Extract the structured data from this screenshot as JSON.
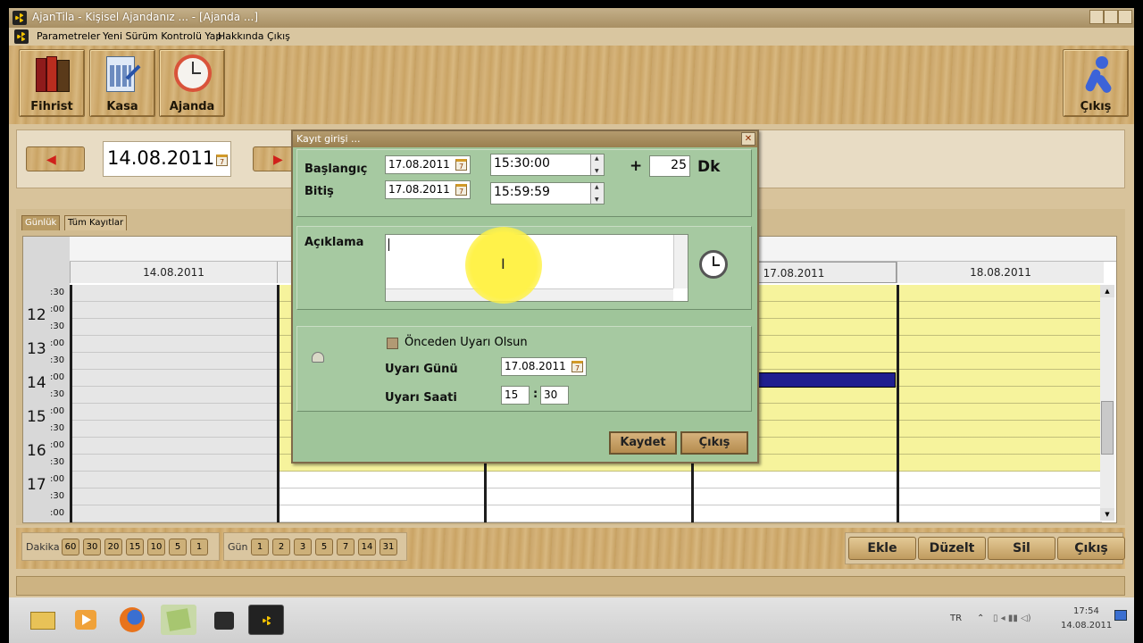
{
  "window": {
    "title": "AjanTila - Kişisel Ajandanız ... - [Ajanda ...]"
  },
  "menu": [
    "Parametreler",
    "Yeni Sürüm Kontrolü Yap",
    "Hakkında",
    "Çıkış"
  ],
  "toolbar": {
    "fihrist": "Fihrist",
    "kasa": "Kasa",
    "ajanda": "Ajanda",
    "cikis": "Çıkış"
  },
  "datenav": {
    "current_date": "14.08.2011"
  },
  "tabs": [
    "Günlük",
    "Tüm Kayıtlar"
  ],
  "grid": {
    "columns": [
      "14.08.2011",
      "17.08.2011",
      "18.08.2011"
    ],
    "hours": [
      "12",
      "13",
      "14",
      "15",
      "16",
      "17"
    ],
    "minutes": [
      ":30",
      ":00",
      ":30",
      ":00",
      ":30",
      ":00",
      ":30",
      ":00",
      ":30",
      ":00",
      ":30",
      ":00",
      ":30",
      ":00"
    ]
  },
  "bottom": {
    "dakika_label": "Dakika",
    "dakika_values": [
      "60",
      "30",
      "20",
      "15",
      "10",
      "5",
      "1"
    ],
    "gun_label": "Gün",
    "gun_values": [
      "1",
      "2",
      "3",
      "5",
      "7",
      "14",
      "31"
    ],
    "actions": [
      "Ekle",
      "Düzelt",
      "Sil",
      "Çıkış"
    ]
  },
  "dialog": {
    "title": "Kayıt girişi ...",
    "baslangic_label": "Başlangıç",
    "bitis_label": "Bitiş",
    "start_date": "17.08.2011",
    "end_date": "17.08.2011",
    "start_time": "15:30:00",
    "end_time": "15:59:59",
    "plus": "+",
    "duration": "25",
    "duration_unit": "Dk",
    "aciklama_label": "Açıklama",
    "reminder_checkbox": "Önceden Uyarı Olsun",
    "uyari_gunu_label": "Uyarı Günü",
    "uyari_gunu": "17.08.2011",
    "uyari_saati_label": "Uyarı Saati",
    "uyari_hour": "15",
    "uyari_sep": ":",
    "uyari_minute": "30",
    "save": "Kaydet",
    "exit": "Çıkış"
  },
  "taskbar": {
    "lang": "TR",
    "time": "17:54",
    "date": "14.08.2011"
  },
  "colors": {
    "accent": "#b58c4f",
    "dialog_bg": "#9fc59a",
    "grid_busy": "#f6f39c",
    "event": "#1f1f8f"
  }
}
